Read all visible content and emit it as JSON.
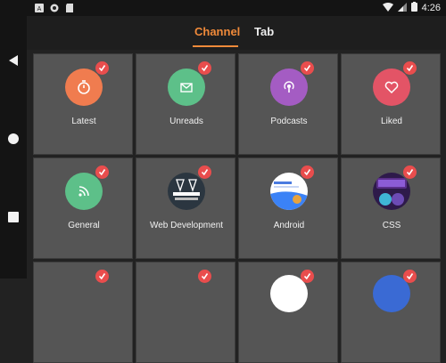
{
  "status": {
    "time": "4:26"
  },
  "tabs": [
    {
      "label": "Channel",
      "active": true
    },
    {
      "label": "Tab",
      "active": false
    }
  ],
  "colors": {
    "accent": "#f08a3a",
    "check": "#e94d4d"
  },
  "tiles": [
    {
      "label": "Latest",
      "icon": "stopwatch-icon",
      "color": "#f07c4f"
    },
    {
      "label": "Unreads",
      "icon": "envelope-icon",
      "color": "#5dc089"
    },
    {
      "label": "Podcasts",
      "icon": "podcast-icon",
      "color": "#a45cc3"
    },
    {
      "label": "Liked",
      "icon": "heart-icon",
      "color": "#e35466"
    },
    {
      "label": "General",
      "icon": "rss-icon",
      "color": "#5dc089"
    },
    {
      "label": "Web Development",
      "icon": "front-end-happy-hour-thumbnail",
      "color": "#2b3640"
    },
    {
      "label": "Android",
      "icon": "android-thumbnail",
      "color": "#ffffff"
    },
    {
      "label": "CSS",
      "icon": "css-podcast-thumbnail",
      "color": "#2e1a4a"
    }
  ]
}
